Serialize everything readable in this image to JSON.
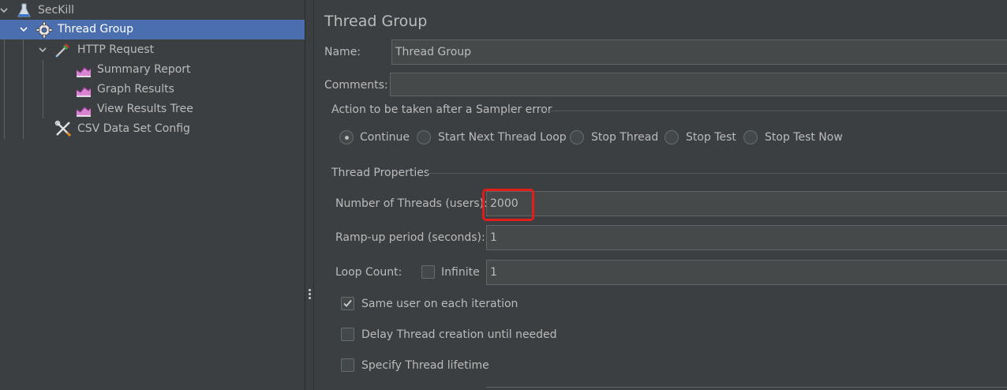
{
  "tree": {
    "items": [
      {
        "label": "SecKill",
        "icon": "flask-icon"
      },
      {
        "label": "Thread Group",
        "icon": "gear-icon",
        "selected": true
      },
      {
        "label": "HTTP Request",
        "icon": "pipette-icon"
      },
      {
        "label": "Summary Report",
        "icon": "graph-icon"
      },
      {
        "label": "Graph Results",
        "icon": "graph-icon"
      },
      {
        "label": "View Results Tree",
        "icon": "graph-icon"
      },
      {
        "label": "CSV Data Set Config",
        "icon": "wrench-icon"
      }
    ]
  },
  "panel": {
    "title": "Thread Group",
    "name_label": "Name:",
    "name_value": "Thread Group",
    "comments_label": "Comments:",
    "comments_value": "",
    "sampler_error": {
      "legend": "Action to be taken after a Sampler error",
      "options": [
        "Continue",
        "Start Next Thread Loop",
        "Stop Thread",
        "Stop Test",
        "Stop Test Now"
      ],
      "selected": "Continue"
    },
    "thread_props": {
      "legend": "Thread Properties",
      "threads_label": "Number of Threads (users):",
      "threads_value": "2000",
      "rampup_label": "Ramp-up period (seconds):",
      "rampup_value": "1",
      "loop_label": "Loop Count:",
      "infinite_label": "Infinite",
      "infinite_checked": false,
      "loop_value": "1",
      "same_user_label": "Same user on each iteration",
      "same_user_checked": true,
      "delay_label": "Delay Thread creation until needed",
      "delay_checked": false,
      "lifetime_label": "Specify Thread lifetime",
      "lifetime_checked": false
    }
  },
  "colors": {
    "background": "#3c3f41",
    "selection": "#4b6eaf",
    "highlight": "#e31c1c",
    "text": "#bbbbbb"
  }
}
